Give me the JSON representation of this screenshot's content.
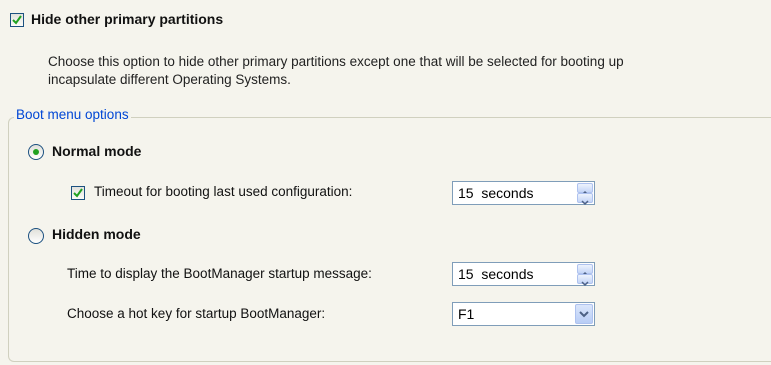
{
  "hide_partitions": {
    "checked": true,
    "label": "Hide other primary partitions",
    "description_line1": "Choose this option to hide other primary partitions except one that will be selected for booting up",
    "description_line2": "incapsulate different Operating Systems."
  },
  "boot_menu": {
    "legend": "Boot menu options",
    "normal_mode": {
      "label": "Normal mode",
      "selected": true,
      "timeout_checkbox_label": "Timeout for booting last used configuration:",
      "timeout_checked": true,
      "timeout_value": "15  seconds"
    },
    "hidden_mode": {
      "label": "Hidden mode",
      "selected": false,
      "display_time_label": "Time to display the BootManager startup message:",
      "display_time_value": "15  seconds",
      "hotkey_label": "Choose a hot key for startup BootManager:",
      "hotkey_value": "F1"
    }
  }
}
